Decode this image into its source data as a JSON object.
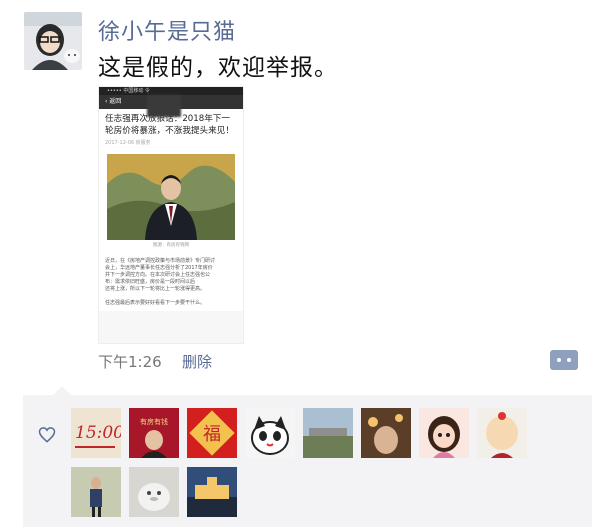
{
  "post": {
    "username": "徐小午是只猫",
    "text": "这是假的，欢迎举报。",
    "time": "下午1:26",
    "delete_label": "删除"
  },
  "screenshot": {
    "status_text": "••••• 中国移动 令",
    "nav_back": "‹ 返回",
    "article_title": "任志强再次放狠话：2018年下一\n轮房价将暴涨，不涨我提头来见！",
    "article_meta": "2017-12-06  房服务",
    "photo_caption": "图源：有房有钱网",
    "article_body": "近日，在《房地产调控政策与市场前景》专门研讨\n会上，华远地产董事长任志强分析了2017年房价\n并下一步调控方向。在本次研讨会上任志强也公\n布：需求依旧旺盛，房价是一段时间以后\n还将上涨，所以下一轮将比上一轮涨得更高。\n\n任志强最后表示要好好看看下一步要干什么。"
  },
  "likes": {
    "icon": "heart-outline-icon",
    "avatars": [
      {
        "name": "liker-avatar-1",
        "label": "15:00",
        "bg": "#efe4d2",
        "fg": "#c0262c"
      },
      {
        "name": "liker-avatar-2",
        "label": "有房有钱",
        "bg": "#a8162a",
        "fg": "#f5d98a"
      },
      {
        "name": "liker-avatar-3",
        "label": "福",
        "bg": "#d41f1f",
        "fg": "#f6d36b"
      },
      {
        "name": "liker-avatar-4",
        "label": "",
        "bg": "#f5f5f5",
        "fg": "#222"
      },
      {
        "name": "liker-avatar-5",
        "label": "",
        "bg": "#7d8a78",
        "fg": "#fff"
      },
      {
        "name": "liker-avatar-6",
        "label": "",
        "bg": "#7a5a3a",
        "fg": "#fff"
      },
      {
        "name": "liker-avatar-7",
        "label": "",
        "bg": "#fbe7e2",
        "fg": "#333"
      },
      {
        "name": "liker-avatar-8",
        "label": "",
        "bg": "#f2efe8",
        "fg": "#333"
      },
      {
        "name": "liker-avatar-9",
        "label": "",
        "bg": "#b7b49a",
        "fg": "#333"
      },
      {
        "name": "liker-avatar-10",
        "label": "",
        "bg": "#c9c7c2",
        "fg": "#333"
      },
      {
        "name": "liker-avatar-11",
        "label": "",
        "bg": "#314d7a",
        "fg": "#f3c76a"
      }
    ]
  },
  "colors": {
    "link": "#576b95",
    "likes_bg": "#f3f3f5"
  }
}
